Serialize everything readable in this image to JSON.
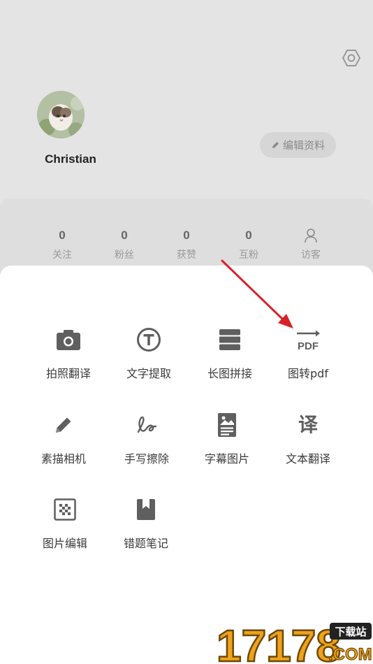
{
  "profile": {
    "username": "Christian",
    "edit_label": "编辑资料"
  },
  "stats": [
    {
      "value": "0",
      "label": "关注"
    },
    {
      "value": "0",
      "label": "粉丝"
    },
    {
      "value": "0",
      "label": "获赞"
    },
    {
      "value": "0",
      "label": "互粉"
    },
    {
      "label": "访客",
      "icon": "person-icon"
    }
  ],
  "tools": [
    {
      "label": "拍照翻译",
      "icon": "camera-icon"
    },
    {
      "label": "文字提取",
      "icon": "text-t-icon"
    },
    {
      "label": "长图拼接",
      "icon": "long-image-icon"
    },
    {
      "label": "图转pdf",
      "icon": "pdf-icon",
      "icon_text": "PDF"
    },
    {
      "label": "素描相机",
      "icon": "pencil-icon"
    },
    {
      "label": "手写擦除",
      "icon": "handwriting-icon"
    },
    {
      "label": "字幕图片",
      "icon": "subtitle-image-icon"
    },
    {
      "label": "文本翻译",
      "icon": "translate-icon",
      "icon_text": "译"
    },
    {
      "label": "图片编辑",
      "icon": "image-edit-icon"
    },
    {
      "label": "错题笔记",
      "icon": "bookmark-note-icon"
    }
  ],
  "watermark": {
    "number": "17178",
    "badge": "下载站",
    "domain": ".COM"
  },
  "colors": {
    "icon": "#5f5f5f",
    "annotation_arrow": "#d8222a",
    "watermark_orange": "#f0a21c"
  }
}
